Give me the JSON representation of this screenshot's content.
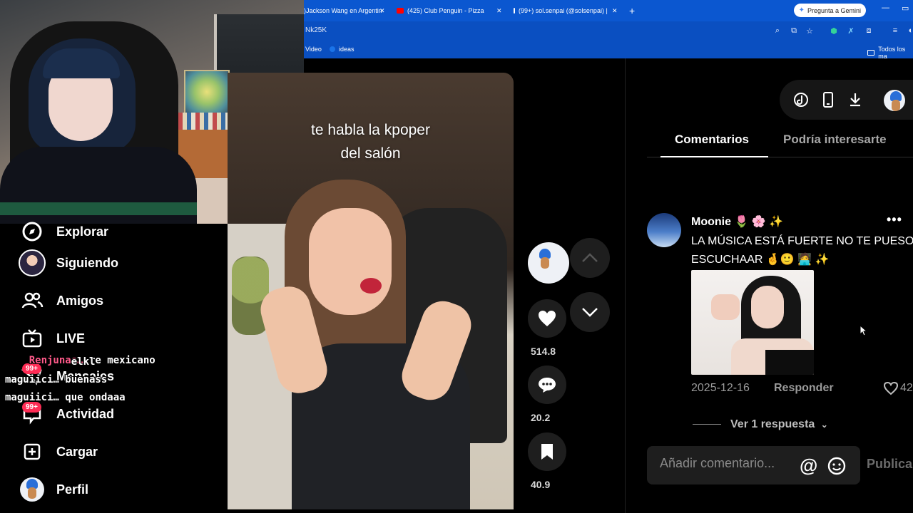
{
  "browser": {
    "tabs": [
      {
        "label": ")Jackson Wang en Argentin",
        "favicon_color": "#ff0000"
      },
      {
        "label": "(425) Club Penguin - Pizza",
        "favicon_color": "#ff0000"
      },
      {
        "label": "(99+) sol.senpai (@solsenpai) | T",
        "favicon_color": "#000000"
      }
    ],
    "gemini_button": "Pregunta a Gemini",
    "url": "Nk25K",
    "bookmarks": {
      "video": "Video",
      "ideas": "ideas",
      "all": "Todos los ma"
    }
  },
  "sidebar": {
    "items": [
      {
        "label": "Explorar",
        "icon": "compass-icon"
      },
      {
        "label": "Siguiendo",
        "icon": "following-avatar"
      },
      {
        "label": "Amigos",
        "icon": "friends-icon"
      },
      {
        "label": "LIVE",
        "icon": "live-icon"
      },
      {
        "label": "Mensajes",
        "icon": "messages-icon",
        "badge": "99+"
      },
      {
        "label": "Actividad",
        "icon": "activity-icon",
        "badge": "99+"
      },
      {
        "label": "Cargar",
        "icon": "upload-icon"
      },
      {
        "label": "Perfil",
        "icon": "profile-avatar"
      }
    ]
  },
  "chat": {
    "line1_user": "Renjunas…",
    "line1_msg": " re mexicano",
    "line2": "           elkl",
    "line3": "maguiici… buenass",
    "line4": "maguiici… que ondaaa"
  },
  "video": {
    "caption_line1": "te habla la kpoper",
    "caption_line2": "del salón"
  },
  "actions": {
    "like_count": "514.8",
    "comment_count": "20.2",
    "save_count": "40.9"
  },
  "panel": {
    "tab_comments": "Comentarios",
    "tab_related": "Podría interesarte",
    "comment": {
      "username": "Moonie",
      "username_emoji": "🌷 🌸 ✨",
      "text_line1": "LA MÚSICA ESTÁ FUERTE NO TE PUESO",
      "text_line2": "ESCUCHAAR 🤞🙂 🧑‍💻 ✨",
      "date": "2025-12-16",
      "reply_label": "Responder",
      "like_count": "42",
      "view_replies": "Ver 1 respuesta"
    },
    "input_placeholder": "Añadir comentario...",
    "publish_label": "Publica"
  },
  "colors": {
    "accent": "#fe2c55",
    "chrome_blue": "#0b57d0"
  }
}
